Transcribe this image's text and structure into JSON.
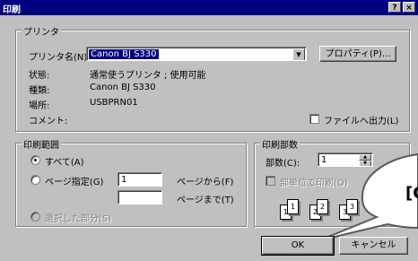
{
  "window": {
    "title": "印刷",
    "help_button": "?",
    "close_button": "×"
  },
  "printer": {
    "group_title": "プリンタ",
    "name_label": "プリンタ名(N):",
    "name_value": "Canon BJ S330",
    "properties_button": "プロパティ(P)...",
    "status_label": "状態:",
    "status_value": "通常使うプリンタ ; 使用可能",
    "type_label": "種類:",
    "type_value": "Canon BJ S330",
    "location_label": "場所:",
    "location_value": "USBPRN01",
    "comment_label": "コメント:",
    "print_to_file_label": "ファイルへ出力(L)"
  },
  "range": {
    "group_title": "印刷範囲",
    "all_label": "すべて(A)",
    "pages_label": "ページ指定(G)",
    "from_value": "1",
    "from_label": "ページから(F)",
    "to_value": "",
    "to_label": "ページまで(T)",
    "selection_label": "選択した部分(S)"
  },
  "copies": {
    "group_title": "印刷部数",
    "count_label": "部数(C):",
    "count_value": "1",
    "collate_label": "部単位で印刷(O)",
    "page_icons": [
      "1",
      "1",
      "2",
      "2",
      "3",
      "3"
    ]
  },
  "buttons": {
    "ok": "OK",
    "cancel": "キャンセル"
  },
  "callout": {
    "text": "[O"
  }
}
